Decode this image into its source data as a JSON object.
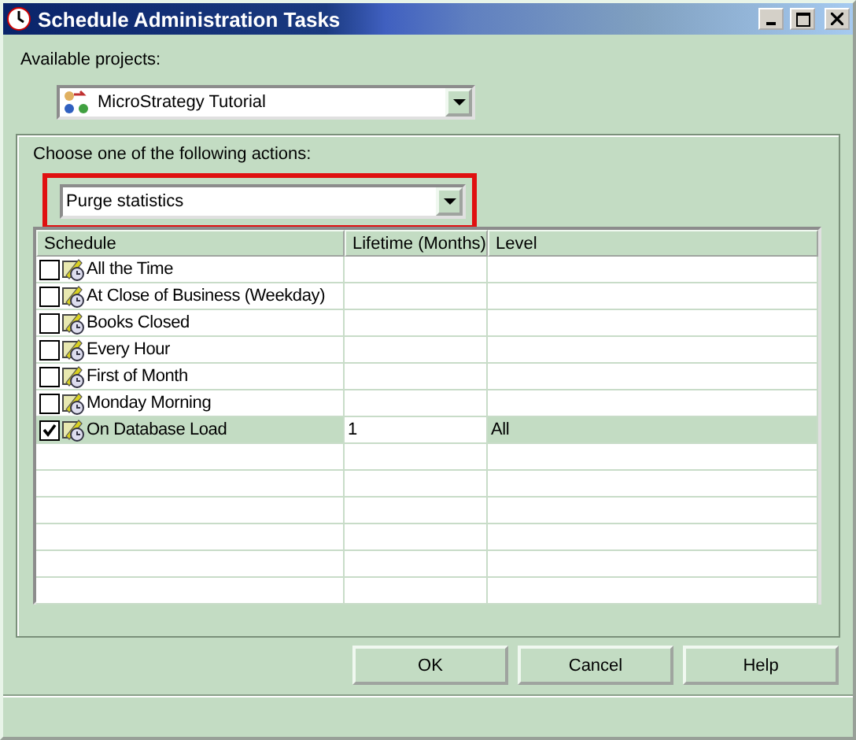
{
  "window": {
    "title": "Schedule Administration Tasks"
  },
  "projects": {
    "label": "Available projects:",
    "value": "MicroStrategy Tutorial"
  },
  "actions": {
    "label": "Choose one of the following actions:",
    "value": "Purge statistics",
    "highlighted": true
  },
  "table": {
    "columns": [
      "Schedule",
      "Lifetime (Months)",
      "Level"
    ],
    "rows": [
      {
        "schedule": "All the Time",
        "checked": false,
        "selected": false
      },
      {
        "schedule": "At Close of Business (Weekday)",
        "checked": false,
        "selected": false
      },
      {
        "schedule": "Books Closed",
        "checked": false,
        "selected": false
      },
      {
        "schedule": "Every Hour",
        "checked": false,
        "selected": false
      },
      {
        "schedule": "First of Month",
        "checked": false,
        "selected": false
      },
      {
        "schedule": "Monday Morning",
        "checked": false,
        "selected": false
      },
      {
        "schedule": "On Database Load",
        "checked": true,
        "selected": true,
        "lifetime": "1",
        "level": "All"
      }
    ]
  },
  "buttons": [
    "OK",
    "Cancel",
    "Help"
  ]
}
